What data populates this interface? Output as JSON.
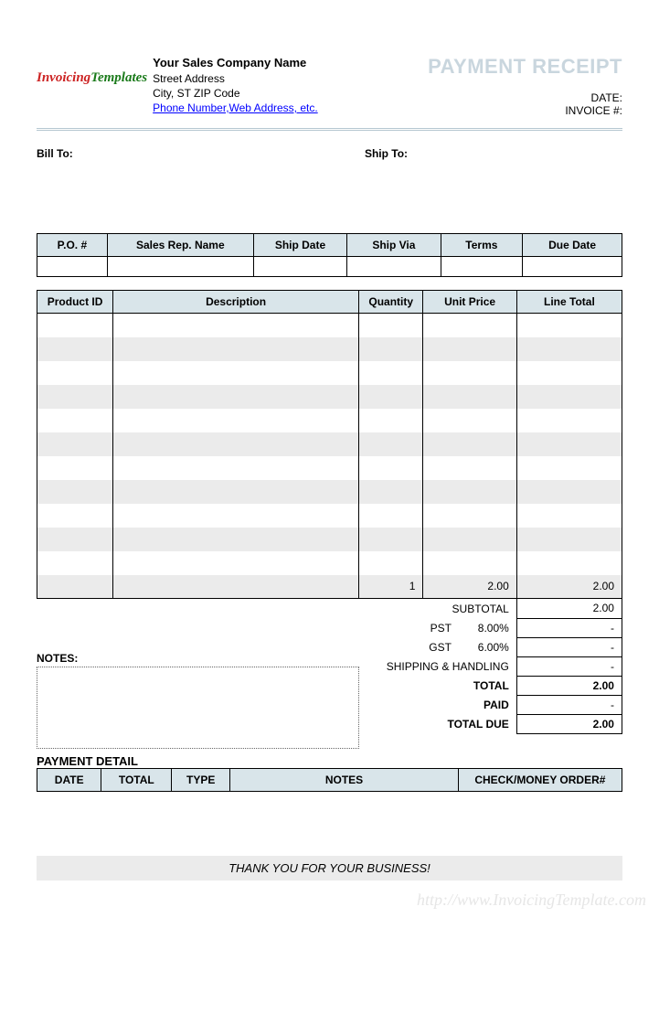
{
  "logo": {
    "part1": "Invoicing",
    "part2": "Templates"
  },
  "company": {
    "name": "Your Sales Company Name",
    "street": "Street Address",
    "city_line": "City, ST  ZIP Code",
    "contact_link": "Phone Number,Web Address, etc."
  },
  "doc_title": "PAYMENT RECEIPT",
  "meta": {
    "date_label": "DATE:",
    "invoice_label": "INVOICE #:"
  },
  "addresses": {
    "bill_to_label": "Bill To:",
    "ship_to_label": "Ship To:"
  },
  "info_headers": [
    "P.O. #",
    "Sales Rep. Name",
    "Ship Date",
    "Ship Via",
    "Terms",
    "Due Date"
  ],
  "info_values": [
    "",
    "",
    "",
    "",
    "",
    ""
  ],
  "item_headers": [
    "Product ID",
    "Description",
    "Quantity",
    "Unit Price",
    "Line Total"
  ],
  "item_rows": [
    [
      "",
      "",
      "",
      "",
      ""
    ],
    [
      "",
      "",
      "",
      "",
      ""
    ],
    [
      "",
      "",
      "",
      "",
      ""
    ],
    [
      "",
      "",
      "",
      "",
      ""
    ],
    [
      "",
      "",
      "",
      "",
      ""
    ],
    [
      "",
      "",
      "",
      "",
      ""
    ],
    [
      "",
      "",
      "",
      "",
      ""
    ],
    [
      "",
      "",
      "",
      "",
      ""
    ],
    [
      "",
      "",
      "",
      "",
      ""
    ],
    [
      "",
      "",
      "",
      "",
      ""
    ],
    [
      "",
      "",
      "",
      "",
      ""
    ],
    [
      "",
      "",
      "1",
      "2.00",
      "2.00"
    ]
  ],
  "notes_label": "NOTES:",
  "totals": {
    "subtotal_label": "SUBTOTAL",
    "subtotal_value": "2.00",
    "pst_label": "PST",
    "pst_pct": "8.00%",
    "pst_value": "-",
    "gst_label": "GST",
    "gst_pct": "6.00%",
    "gst_value": "-",
    "shipping_label": "SHIPPING & HANDLING",
    "shipping_value": "-",
    "total_label": "TOTAL",
    "total_value": "2.00",
    "paid_label": "PAID",
    "paid_value": "-",
    "due_label": "TOTAL DUE",
    "due_value": "2.00"
  },
  "payment_detail_label": "PAYMENT DETAIL",
  "payment_headers": [
    "DATE",
    "TOTAL",
    "TYPE",
    "NOTES",
    "CHECK/MONEY ORDER#"
  ],
  "thank_you": "THANK YOU FOR YOUR BUSINESS!",
  "watermark": "http://www.InvoicingTemplate.com"
}
